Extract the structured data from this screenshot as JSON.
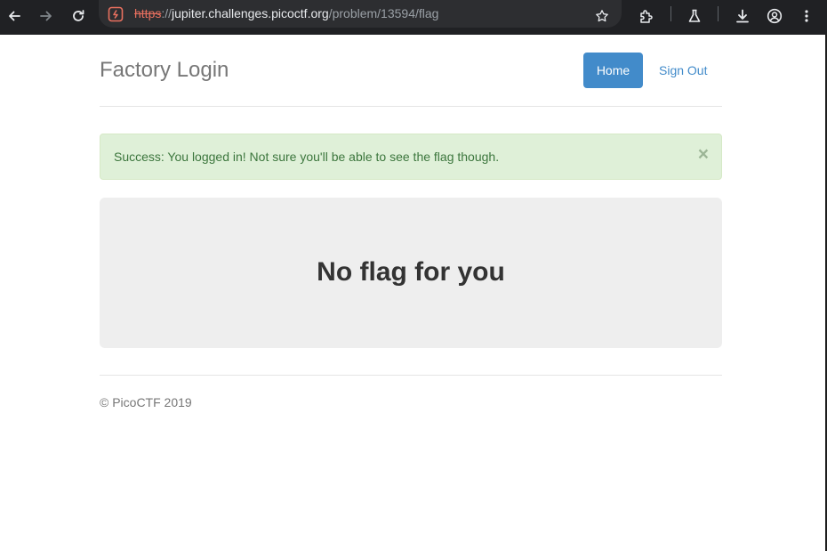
{
  "browser": {
    "url": {
      "scheme": "https",
      "separator": "://",
      "host": "jupiter.challenges.picoctf.org",
      "path": "/problem/13594/flag"
    },
    "security_state": "not-secure",
    "colors": {
      "toolbar_bg": "#202124",
      "scheme_warning": "#e8705f"
    }
  },
  "header": {
    "brand": "Factory Login",
    "nav": {
      "home_label": "Home",
      "signout_label": "Sign Out"
    }
  },
  "alert": {
    "message": "Success: You logged in! Not sure you'll be able to see the flag though.",
    "close_glyph": "×",
    "type": "success"
  },
  "jumbotron": {
    "heading": "No flag for you"
  },
  "footer": {
    "text": "© PicoCTF 2019"
  },
  "colors": {
    "primary": "#428bca",
    "alert_bg": "#dff0d8",
    "alert_text": "#3c763d",
    "jumbotron_bg": "#eeeeee"
  }
}
